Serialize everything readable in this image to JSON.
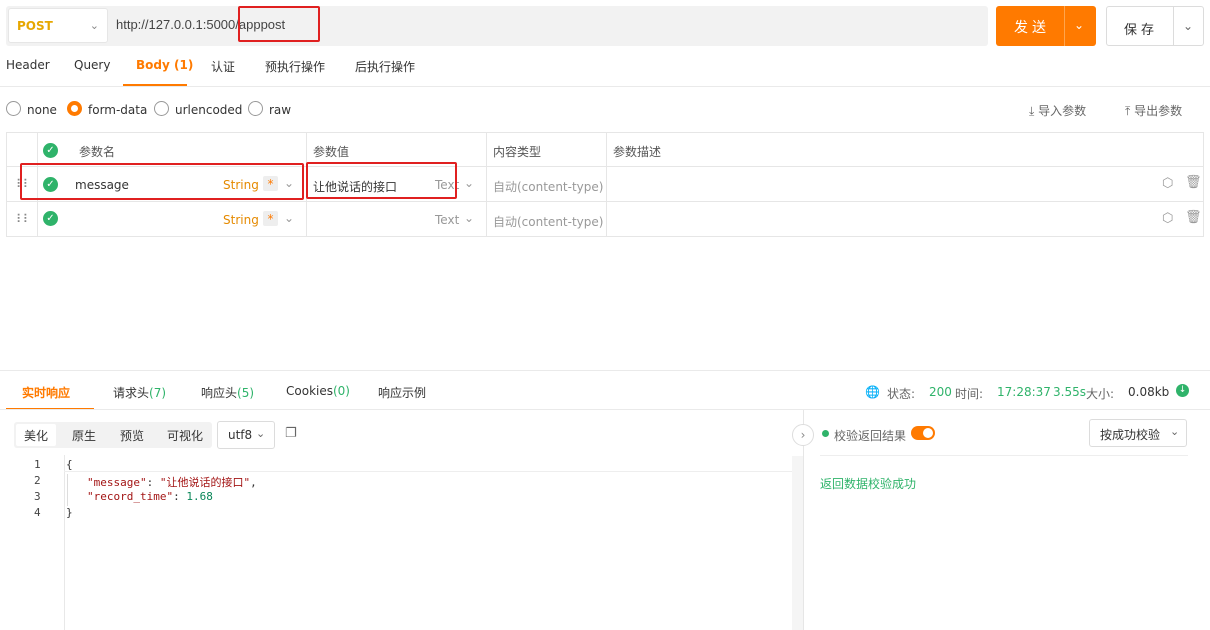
{
  "request": {
    "method": "POST",
    "url_base": "http://127.0.0.1:500",
    "url_tail": "0/apppost",
    "send_label": "发送",
    "save_label": "保存"
  },
  "tabs": [
    {
      "label": "Header"
    },
    {
      "label": "Query"
    },
    {
      "label": "Body (1)"
    },
    {
      "label": "认证"
    },
    {
      "label": "预执行操作"
    },
    {
      "label": "后执行操作"
    }
  ],
  "body_modes": [
    "none",
    "form-data",
    "urlencoded",
    "raw"
  ],
  "import_label": "导入参数",
  "export_label": "导出参数",
  "table": {
    "headers": [
      "参数名",
      "参数值",
      "内容类型",
      "参数描述"
    ],
    "rows": [
      {
        "name": "message",
        "type": "String",
        "required": "*",
        "value": "让他说话的接口",
        "value_type": "Text",
        "content_type": "自动(content-type)"
      },
      {
        "name": "",
        "type": "String",
        "required": "*",
        "value": "",
        "value_type": "Text",
        "content_type": "自动(content-type)"
      }
    ]
  },
  "response": {
    "tabs": [
      {
        "label": "实时响应",
        "count": ""
      },
      {
        "label": "请求头",
        "count": "(7)"
      },
      {
        "label": "响应头",
        "count": "(5)"
      },
      {
        "label": "Cookies",
        "count": "(0)"
      },
      {
        "label": "响应示例",
        "count": ""
      }
    ],
    "status_label": "状态:",
    "status_value": "200",
    "time_label": "时间:",
    "time_value": "17:28:37",
    "duration": "3.55s",
    "size_label": "大小:",
    "size_value": "0.08kb",
    "views": [
      "美化",
      "原生",
      "预览",
      "可视化"
    ],
    "encoding": "utf8",
    "code": {
      "l1": "{",
      "key1": "\"message\"",
      "val1": "\"让他说话的接口\"",
      "key2": "\"record_time\"",
      "val2": "1.68",
      "l4": "}"
    },
    "line_numbers": [
      "1",
      "2",
      "3",
      "4"
    ],
    "validate_label": "校验返回结果",
    "validate_mode": "按成功校验",
    "validate_result": "返回数据校验成功"
  },
  "colors": {
    "accent": "#ff7a00",
    "success": "#2fb36a",
    "highlight": "#e02020"
  }
}
